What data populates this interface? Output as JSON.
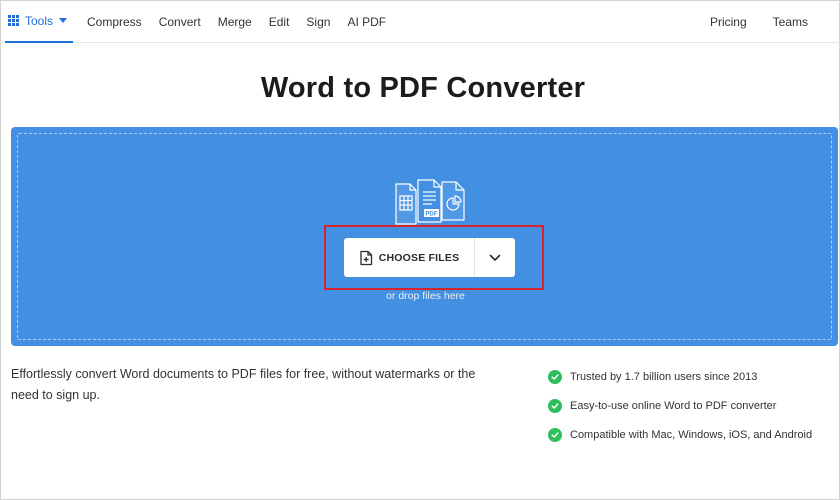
{
  "nav": {
    "tools_label": "Tools",
    "links": [
      "Compress",
      "Convert",
      "Merge",
      "Edit",
      "Sign",
      "AI PDF"
    ],
    "right_links": [
      "Pricing",
      "Teams"
    ]
  },
  "page": {
    "title": "Word to PDF Converter"
  },
  "dropzone": {
    "button_label": "CHOOSE FILES",
    "drop_text": "or drop files here",
    "icon_pdf_label": "PDF"
  },
  "description": "Effortlessly convert Word documents to PDF files for free, without watermarks or the need to sign up.",
  "features": [
    "Trusted by 1.7 billion users since 2013",
    "Easy-to-use online Word to PDF converter",
    "Compatible with Mac, Windows, iOS, and Android"
  ],
  "colors": {
    "accent": "#1e6fd9",
    "dropzone_bg": "#4390e3",
    "highlight": "#d9232b",
    "check": "#2fbe5c"
  }
}
